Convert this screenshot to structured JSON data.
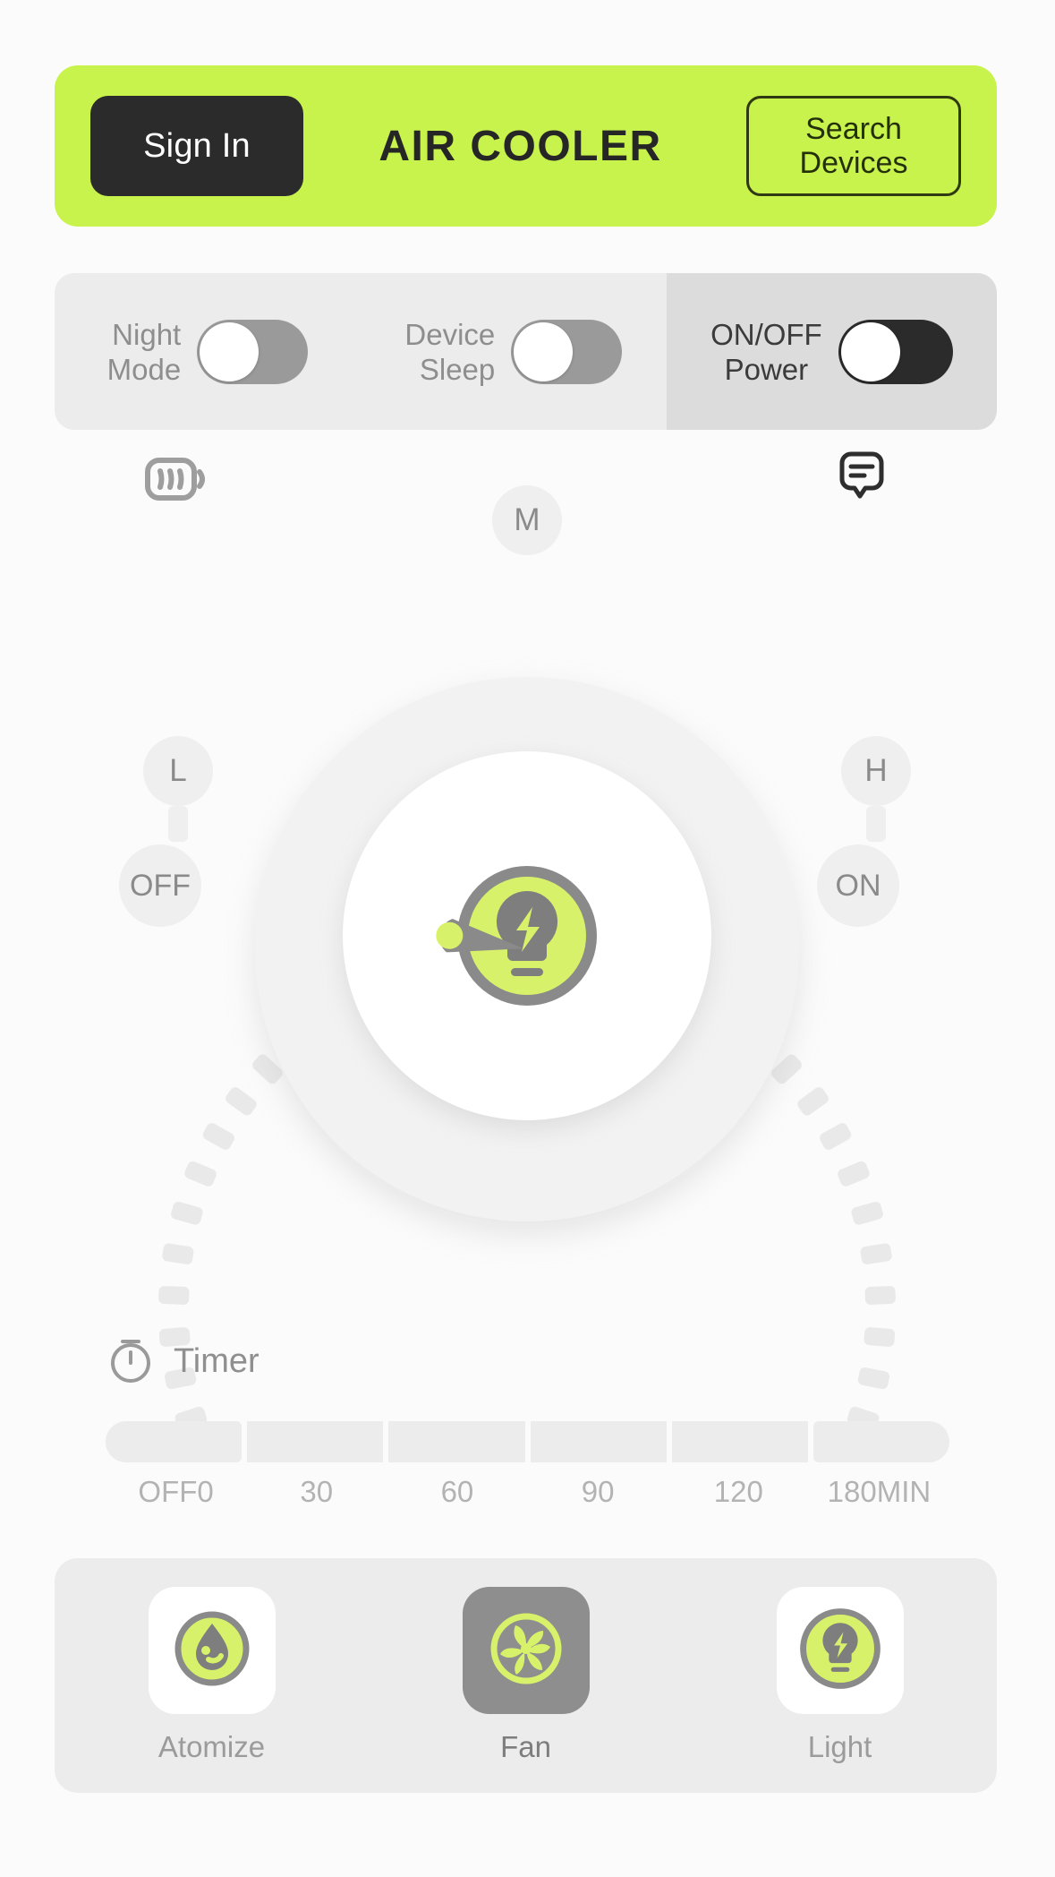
{
  "header": {
    "signin_label": "Sign In",
    "title": "AIR COOLER",
    "search_line1": "Search",
    "search_line2": "Devices",
    "brand_color": "#c8f24c",
    "dark_color": "#2b2b2b"
  },
  "toggles": [
    {
      "label_line1": "Night",
      "label_line2": "Mode",
      "state": "off",
      "track_color": "#9a9a9a"
    },
    {
      "label_line1": "Device",
      "label_line2": "Sleep",
      "state": "off",
      "track_color": "#9a9a9a"
    },
    {
      "label_line1": "ON/OFF",
      "label_line2": "Power",
      "state": "off",
      "track_color": "#2b2b2b"
    }
  ],
  "status_icons": {
    "battery": "battery-icon",
    "chat": "chat-bubble-icon"
  },
  "dial": {
    "speed_labels": [
      "L",
      "M",
      "H"
    ],
    "power_labels": [
      "OFF",
      "ON"
    ],
    "selected": "OFF",
    "center_icon": "lightbulb-bolt-icon",
    "accent_color": "#d7f26a",
    "needle_color": "#8a8a8a"
  },
  "timer": {
    "title": "Timer",
    "icon": "stopwatch-icon",
    "options": [
      "OFF0",
      "30",
      "60",
      "90",
      "120",
      "180MIN"
    ],
    "selected": "OFF0"
  },
  "tabs": [
    {
      "label": "Atomize",
      "icon": "water-drop-icon",
      "active": false
    },
    {
      "label": "Fan",
      "icon": "fan-turbine-icon",
      "active": true
    },
    {
      "label": "Light",
      "icon": "lightbulb-bolt-icon",
      "active": false
    }
  ]
}
